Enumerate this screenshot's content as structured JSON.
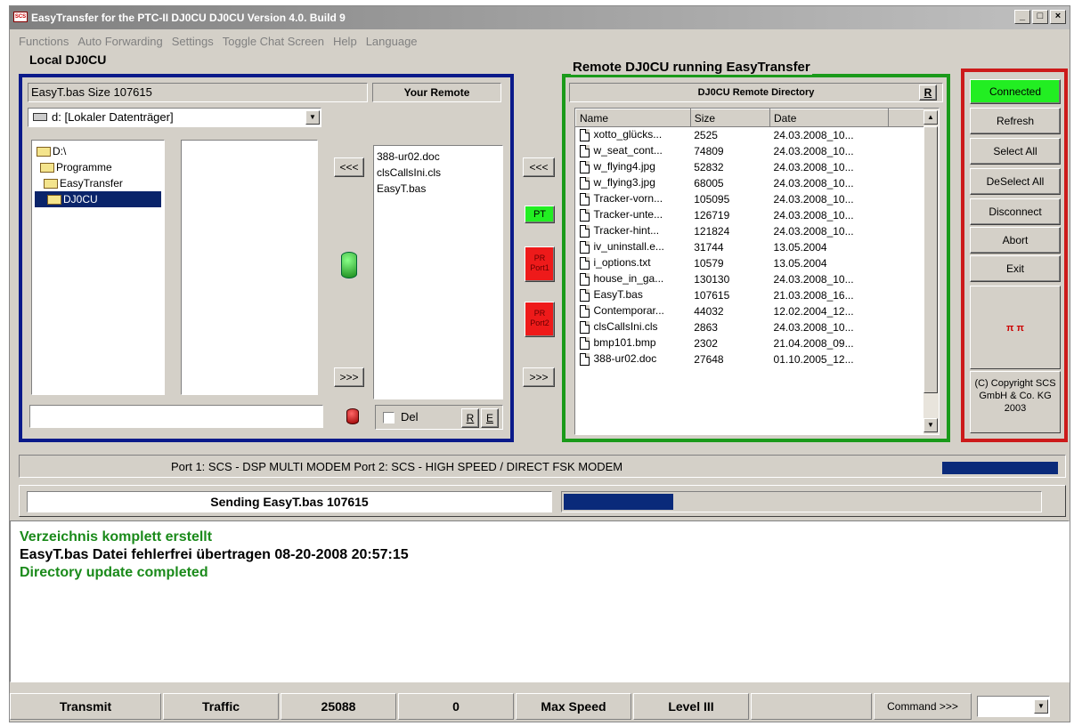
{
  "window": {
    "title": "EasyTransfer for the PTC-II DJ0CU DJ0CU Version 4.0. Build 9"
  },
  "menu": [
    "Functions",
    "Auto Forwarding",
    "Settings",
    "Toggle Chat Screen",
    "Help",
    "Language"
  ],
  "local": {
    "group_title": "Local DJ0CU",
    "file_info": "EasyT.bas Size 107615",
    "your_remote_label": "Your Remote",
    "drive": "d: [Lokaler Datenträger]",
    "tree": [
      "D:\\",
      "Programme",
      "EasyTransfer",
      "DJ0CU"
    ],
    "queue_files": [
      "388-ur02.doc",
      "clsCallsIni.cls",
      "EasyT.bas"
    ],
    "left_arrow": "<<<",
    "right_arrow": ">>>",
    "del_label": "Del",
    "r_label": "R",
    "e_label": "E"
  },
  "middle": {
    "left_arrow": "<<<",
    "pt_label": "PT",
    "pr_port1": "PR\nPort1",
    "pr_port2": "PR\nPort2",
    "right_arrow": ">>>"
  },
  "remote": {
    "group_title": "Remote DJ0CU running EasyTransfer",
    "header": "DJ0CU Remote Directory",
    "r_label": "R",
    "columns": [
      "Name",
      "Size",
      "Date"
    ],
    "rows": [
      [
        "xotto_glücks...",
        "2525",
        "24.03.2008_10..."
      ],
      [
        "w_seat_cont...",
        "74809",
        "24.03.2008_10..."
      ],
      [
        "w_flying4.jpg",
        "52832",
        "24.03.2008_10..."
      ],
      [
        "w_flying3.jpg",
        "68005",
        "24.03.2008_10..."
      ],
      [
        "Tracker-vorn...",
        "105095",
        "24.03.2008_10..."
      ],
      [
        "Tracker-unte...",
        "126719",
        "24.03.2008_10..."
      ],
      [
        "Tracker-hint...",
        "121824",
        "24.03.2008_10..."
      ],
      [
        "iv_uninstall.e...",
        "31744",
        "13.05.2004"
      ],
      [
        "i_options.txt",
        "10579",
        "13.05.2004"
      ],
      [
        "house_in_ga...",
        "130130",
        "24.03.2008_10..."
      ],
      [
        "EasyT.bas",
        "107615",
        "21.03.2008_16..."
      ],
      [
        "Contemporar...",
        "44032",
        "12.02.2004_12..."
      ],
      [
        "clsCallsIni.cls",
        "2863",
        "24.03.2008_10..."
      ],
      [
        "bmp101.bmp",
        "2302",
        "21.04.2008_09..."
      ],
      [
        "388-ur02.doc",
        "27648",
        "01.10.2005_12..."
      ]
    ]
  },
  "controls": {
    "connected": "Connected",
    "refresh": "Refresh",
    "select_all": "Select All",
    "deselect_all": "DeSelect All",
    "disconnect": "Disconnect",
    "abort": "Abort",
    "exit": "Exit",
    "logo": "π π",
    "copyright": "(C) Copyright SCS GmbH & Co. KG 2003"
  },
  "ports_text": "Port 1: SCS - DSP MULTI MODEM  Port 2: SCS - HIGH SPEED / DIRECT FSK MODEM",
  "sending_text": "Sending EasyT.bas 107615",
  "transfer_progress": 0.23,
  "log": [
    {
      "text": "Verzeichnis komplett erstellt",
      "color": "#1a8a1a"
    },
    {
      "text": "EasyT.bas Datei fehlerfrei übertragen 08-20-2008 20:57:15",
      "color": "#000000"
    },
    {
      "text": "Directory update completed",
      "color": "#1a8a1a"
    }
  ],
  "status": {
    "transmit": "Transmit",
    "traffic": "Traffic",
    "count": "25088",
    "zero": "0",
    "max_speed": "Max Speed",
    "level": "Level III",
    "command": "Command >>>"
  },
  "colors": {
    "local_border": "#0a1a8a",
    "remote_border": "#1a9a1a",
    "controls_border": "#cc1a1a",
    "progress": "#0a2a7a",
    "connected_bg": "#22ee22"
  }
}
